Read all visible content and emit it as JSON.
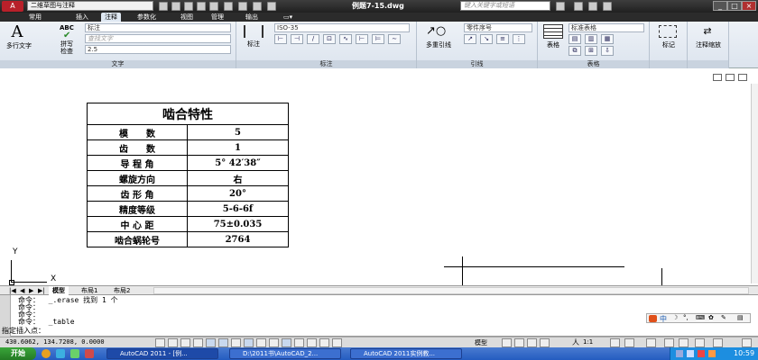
{
  "titlebar": {
    "workspace": "二维草图与注释",
    "file_title": "例题7-15.dwg",
    "search_placeholder": "键入关键字或短语"
  },
  "ribbon_tabs": [
    "常用",
    "插入",
    "注释",
    "参数化",
    "视图",
    "管理",
    "输出"
  ],
  "active_tab": "注释",
  "ribbon": {
    "text_panel": {
      "title": "文字",
      "multiline_text": "多行文字",
      "spell_check_icon": "ABC",
      "spell_check": "拼写\n检查",
      "style_combo": "标注",
      "find_placeholder": "查找文字",
      "height_combo": "2.5"
    },
    "dimension_panel": {
      "title": "标注",
      "dimension": "标注",
      "dimstyle_combo": "ISO-35"
    },
    "leader_panel": {
      "title": "引线",
      "multileader": "多重引线",
      "leader_style_combo": "零件序号"
    },
    "table_panel": {
      "title": "表格",
      "table": "表格",
      "table_style_combo": "标准表格"
    },
    "mark_panel": {
      "markup": "标记"
    },
    "scale_panel": {
      "annotation_scaling": "注释缩放"
    }
  },
  "drawing_table": {
    "title": "啮合特性",
    "rows": [
      [
        "模　　数",
        "5"
      ],
      [
        "齿　　数",
        "1"
      ],
      [
        "导 程 角",
        "5° 42′38″"
      ],
      [
        "螺旋方向",
        "右"
      ],
      [
        "齿 形 角",
        "20°"
      ],
      [
        "精度等级",
        "5-6-6f"
      ],
      [
        "中 心 距",
        "75±0.035"
      ],
      [
        "啮合蜗轮号",
        "2764"
      ]
    ]
  },
  "ucs": {
    "x": "X",
    "y": "Y"
  },
  "layout_tabs": [
    "模型",
    "布局1",
    "布局2"
  ],
  "command_lines": [
    "命令：  _.erase 找到 1 个",
    "命令：",
    "命令：",
    "命令：  _table"
  ],
  "prompt": "指定插入点：",
  "status": {
    "coords": "430.6062, 134.7208, 0.0000",
    "model": "模型",
    "annotation_scale": "1:1"
  },
  "ime": {
    "mode": "中"
  },
  "taskbar": {
    "start": "开始",
    "tasks": [
      "AutoCAD 2011 - [例...",
      "D:\\2011书\\AutoCAD_2...",
      "AutoCAD 2011实例教..."
    ],
    "clock": "10:59"
  }
}
